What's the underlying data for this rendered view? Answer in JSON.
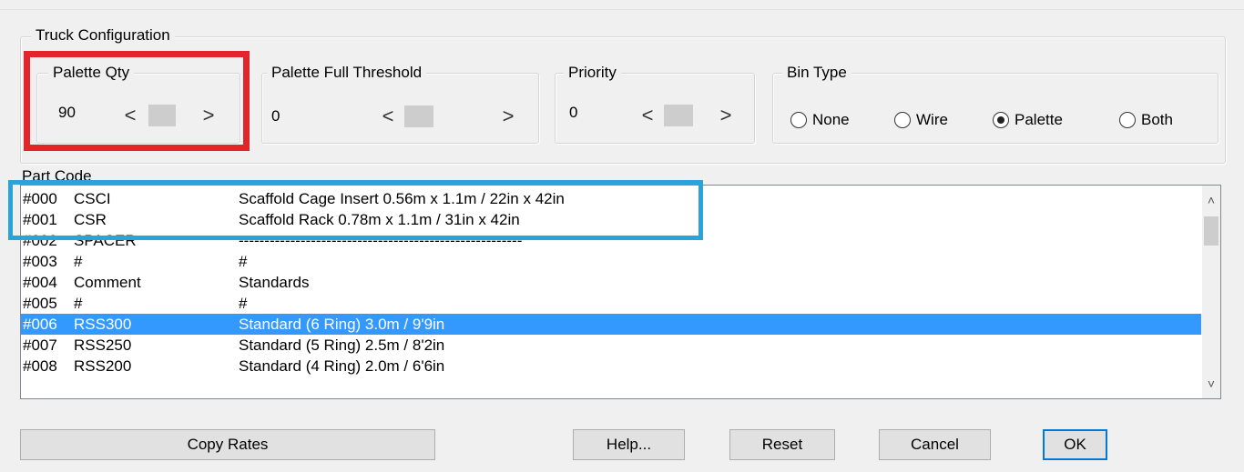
{
  "truck_config": {
    "title": "Truck Configuration",
    "palette_qty": {
      "label": "Palette Qty",
      "value": "90"
    },
    "palette_full_threshold": {
      "label": "Palette Full Threshold",
      "value": "0"
    },
    "priority": {
      "label": "Priority",
      "value": "0"
    },
    "bin_type": {
      "label": "Bin Type",
      "options": [
        "None",
        "Wire",
        "Palette",
        "Both"
      ],
      "selected": "Palette"
    }
  },
  "scroll_arrows": {
    "left": "<",
    "right": ">"
  },
  "part_code": {
    "label": "Part Code",
    "rows": [
      {
        "code": "#000",
        "name": "CSCI",
        "desc": "Scaffold Cage Insert 0.56m x 1.1m / 22in x 42in"
      },
      {
        "code": "#001",
        "name": "CSR",
        "desc": "Scaffold Rack 0.78m x 1.1m / 31in x 42in"
      },
      {
        "code": "#002",
        "name": "SPACER",
        "desc": "-------------------------------------------------------"
      },
      {
        "code": "#003",
        "name": "#",
        "desc": "#"
      },
      {
        "code": "#004",
        "name": "Comment",
        "desc": " Standards"
      },
      {
        "code": "#005",
        "name": "#",
        "desc": "#"
      },
      {
        "code": "#006",
        "name": "RSS300",
        "desc": "Standard (6 Ring) 3.0m / 9'9in"
      },
      {
        "code": "#007",
        "name": "RSS250",
        "desc": "Standard (5 Ring) 2.5m / 8'2in"
      },
      {
        "code": "#008",
        "name": "RSS200",
        "desc": "Standard (4 Ring) 2.0m / 6'6in"
      }
    ],
    "selected_index": 6,
    "scroll_up": "^",
    "scroll_down": "v"
  },
  "buttons": {
    "copy_rates": "Copy Rates",
    "help": "Help...",
    "reset": "Reset",
    "cancel": "Cancel",
    "ok": "OK"
  },
  "colors": {
    "selection": "#3399ff",
    "highlight_red": "#e0262c",
    "highlight_blue": "#2aa3d8",
    "default_button_border": "#0078d7"
  }
}
